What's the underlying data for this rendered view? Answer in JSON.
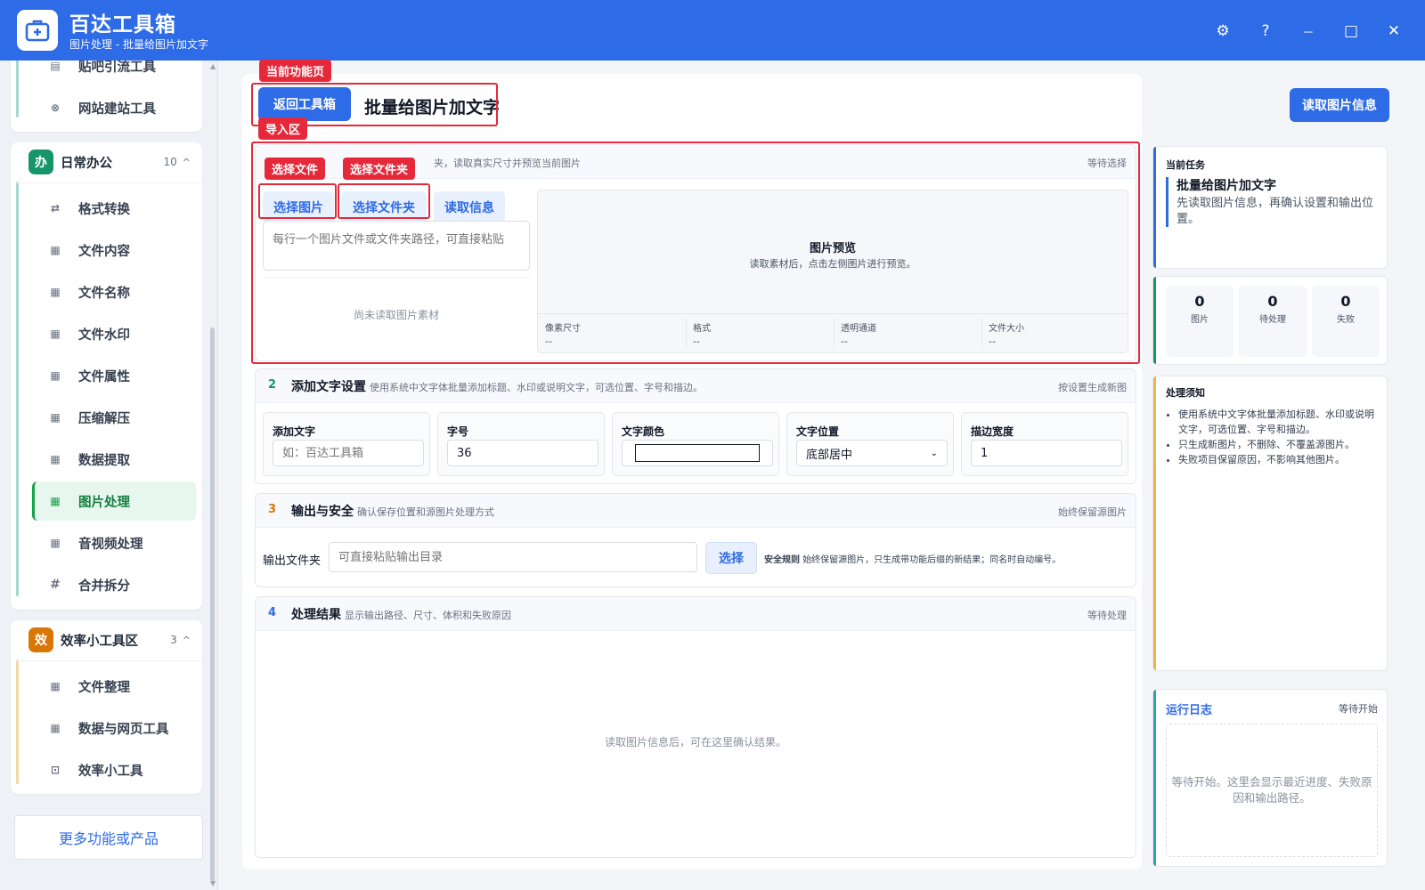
{
  "app": {
    "title": "百达工具箱",
    "subtitle": "图片处理 - 批量给图片加文字",
    "window_controls": {
      "settings": "⚙",
      "help": "?",
      "minimize": "－",
      "maximize": "□",
      "close": "✕"
    }
  },
  "sidebar": {
    "top_items": [
      {
        "label": "贴吧引流工具",
        "icon": "document-icon"
      },
      {
        "label": "网站建站工具",
        "icon": "globe-icon"
      }
    ],
    "group_office": {
      "badge": "办",
      "badge_color": "#16956b",
      "title": "日常办公",
      "count": "10",
      "caret": "^",
      "items": [
        {
          "label": "格式转换",
          "icon": "swap-icon"
        },
        {
          "label": "文件内容",
          "icon": "grid-icon"
        },
        {
          "label": "文件名称",
          "icon": "grid-icon"
        },
        {
          "label": "文件水印",
          "icon": "grid-icon"
        },
        {
          "label": "文件属性",
          "icon": "grid-icon"
        },
        {
          "label": "压缩解压",
          "icon": "grid-icon"
        },
        {
          "label": "数据提取",
          "icon": "grid-icon"
        },
        {
          "label": "图片处理",
          "icon": "grid-icon",
          "active": true
        },
        {
          "label": "音视频处理",
          "icon": "grid-icon"
        },
        {
          "label": "合并拆分",
          "icon": "hash-icon"
        }
      ]
    },
    "group_efficiency": {
      "badge": "效",
      "badge_color": "#d97706",
      "title": "效率小工具区",
      "count": "3",
      "caret": "^",
      "items": [
        {
          "label": "文件整理",
          "icon": "grid-icon"
        },
        {
          "label": "数据与网页工具",
          "icon": "grid-icon"
        },
        {
          "label": "效率小工具",
          "icon": "toolbox-icon"
        }
      ]
    },
    "more_label": "更多功能或产品"
  },
  "main": {
    "back_label": "返回工具箱",
    "page_title": "批量给图片加文字",
    "read_info_label": "读取图片信息",
    "tags": {
      "current_page": "当前功能页",
      "import_area": "导入区",
      "select_file": "选择文件",
      "select_folder": "选择文件夹"
    },
    "import": {
      "desc": "夹，读取真实尺寸并预览当前图片",
      "status": "等待选择",
      "buttons": {
        "pick_images": "选择图片",
        "pick_folder": "选择文件夹",
        "read_info": "读取信息"
      },
      "path_placeholder": "每行一个图片文件或文件夹路径，可直接粘贴",
      "empty": "尚未读取图片素材",
      "preview_title": "图片预览",
      "preview_hint": "读取素材后，点击左侧图片进行预览。",
      "meta": [
        {
          "label": "像素尺寸",
          "value": "--"
        },
        {
          "label": "格式",
          "value": "--"
        },
        {
          "label": "透明通道",
          "value": "--"
        },
        {
          "label": "文件大小",
          "value": "--"
        }
      ]
    },
    "text_settings": {
      "num": "2",
      "num_color": "#16956b",
      "title": "添加文字设置",
      "desc": "使用系统中文字体批量添加标题、水印或说明文字，可选位置、字号和描边。",
      "status": "按设置生成新图",
      "fields": {
        "text": {
          "label": "添加文字",
          "placeholder": "如：百达工具箱"
        },
        "size": {
          "label": "字号",
          "value": "36"
        },
        "color": {
          "label": "文字颜色",
          "value": "#ffffff"
        },
        "position": {
          "label": "文字位置",
          "value": "底部居中"
        },
        "stroke": {
          "label": "描边宽度",
          "value": "1"
        }
      }
    },
    "output": {
      "num": "3",
      "num_color": "#d97706",
      "title": "输出与安全",
      "desc": "确认保存位置和源图片处理方式",
      "status": "始终保留源图片",
      "folder_label": "输出文件夹",
      "folder_placeholder": "可直接粘贴输出目录",
      "choose_label": "选择",
      "rule_title": "安全规则",
      "rule_text": "始终保留源图片，只生成带功能后缀的新结果；同名时自动编号。"
    },
    "results": {
      "num": "4",
      "num_color": "#2e6be6",
      "title": "处理结果",
      "desc": "显示输出路径、尺寸、体积和失败原因",
      "status": "等待处理",
      "empty": "读取图片信息后，可在这里确认结果。"
    }
  },
  "right": {
    "task": {
      "heading": "当前任务",
      "title": "批量给图片加文字",
      "desc": "先读取图片信息，再确认设置和输出位置。"
    },
    "stats": [
      {
        "value": "0",
        "label": "图片"
      },
      {
        "value": "0",
        "label": "待处理"
      },
      {
        "value": "0",
        "label": "失败"
      }
    ],
    "notes": {
      "heading": "处理须知",
      "items": [
        "使用系统中文字体批量添加标题、水印或说明文字，可选位置、字号和描边。",
        "只生成新图片，不删除、不覆盖源图片。",
        "失败项目保留原因，不影响其他图片。"
      ]
    },
    "log": {
      "title": "运行日志",
      "status": "等待开始",
      "empty": "等待开始。这里会显示最近进度、失败原因和输出路径。"
    }
  },
  "colors": {
    "brand": "#2e6be6",
    "annotation": "#e5293b",
    "active_green": "#16a34a"
  }
}
